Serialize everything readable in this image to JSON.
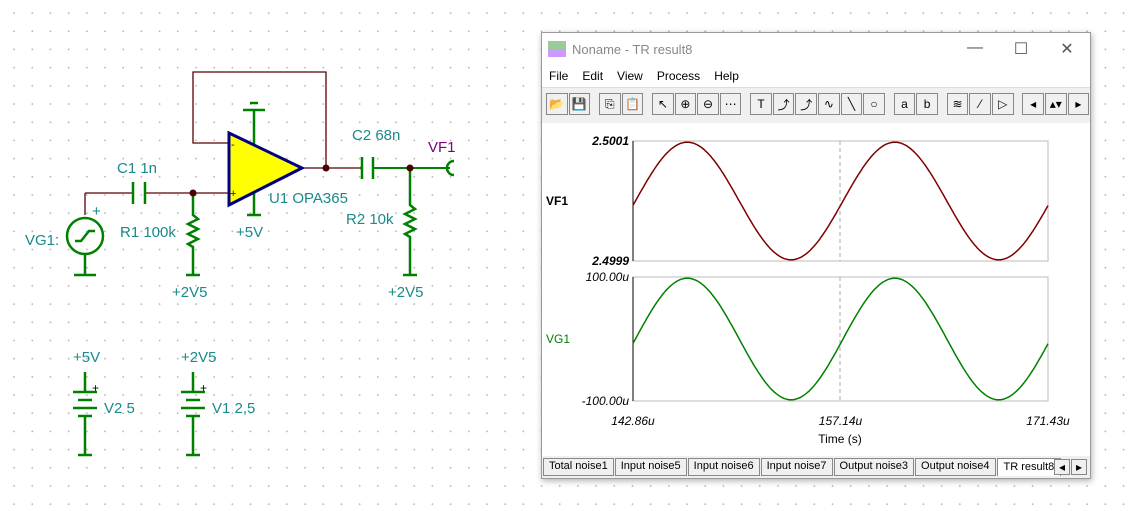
{
  "schematic": {
    "labels": {
      "c1": "C1 1n",
      "r1": "R1 100k",
      "vg1": "VG1:",
      "u1": "U1 OPA365",
      "supply": "+5V",
      "c2": "C2 68n",
      "r2": "R2 10k",
      "vf1": "VF1",
      "r1_ref": "+2V5",
      "r2_ref": "+2V5",
      "v2_node": "+5V",
      "v1_node": "+2V5",
      "v2": "V2 5",
      "v1": "V1 2,5",
      "plus": "+",
      "minus": "-"
    }
  },
  "window": {
    "title": "Noname - TR result8",
    "controls": [
      "—",
      "☐",
      "✕"
    ],
    "menu": [
      "File",
      "Edit",
      "View",
      "Process",
      "Help"
    ],
    "toolbar": [
      {
        "n": "open",
        "g": "📂"
      },
      {
        "n": "save",
        "g": "💾"
      },
      {
        "n": "copy",
        "g": "⎘"
      },
      {
        "n": "paste",
        "g": "📋"
      },
      {
        "n": "pointer",
        "g": "↖"
      },
      {
        "n": "zoom-in",
        "g": "⊕"
      },
      {
        "n": "zoom-100",
        "g": "⊖"
      },
      {
        "n": "grid",
        "g": "⋯"
      },
      {
        "n": "text",
        "g": "T"
      },
      {
        "n": "label-curve",
        "g": "⤴"
      },
      {
        "n": "label-query",
        "g": "⤴"
      },
      {
        "n": "legend",
        "g": "∿"
      },
      {
        "n": "line",
        "g": "╲"
      },
      {
        "n": "ellipse",
        "g": "○"
      },
      {
        "n": "cursor-a",
        "g": "a"
      },
      {
        "n": "cursor-b",
        "g": "b"
      },
      {
        "n": "waves",
        "g": "≋"
      },
      {
        "n": "probe",
        "g": "⁄"
      },
      {
        "n": "flag",
        "g": "▷"
      }
    ],
    "tabs": [
      "Total noise1",
      "Input noise5",
      "Input noise6",
      "Input noise7",
      "Output noise3",
      "Output noise4",
      "TR result8"
    ],
    "active_tab": "TR result8"
  },
  "chart_data": [
    {
      "type": "line",
      "series": [
        {
          "name": "VF1",
          "color": "#800000",
          "shape": "sine",
          "offset": 2.5,
          "amplitude": 0.0001,
          "period_us": 14.29,
          "peak_time_us": 146.6
        }
      ],
      "ylim": [
        2.4999,
        2.5001
      ],
      "ytick_labels": [
        "2.5001",
        "2.4999"
      ],
      "xlim": [
        142.86,
        171.43
      ],
      "xtick_labels": [
        "142.86u",
        "157.14u",
        "171.43u"
      ]
    },
    {
      "type": "line",
      "series": [
        {
          "name": "VG1",
          "color": "#008000",
          "shape": "sine",
          "offset": 0,
          "amplitude": 100,
          "period_us": 14.29,
          "peak_time_us": 146.6
        }
      ],
      "ylim": [
        -100,
        100
      ],
      "ytick_labels": [
        "100.00u",
        "-100.00u"
      ],
      "xlim": [
        142.86,
        171.43
      ],
      "xtick_labels": [
        "142.86u",
        "157.14u",
        "171.43u"
      ],
      "xlabel": "Time (s)"
    }
  ]
}
